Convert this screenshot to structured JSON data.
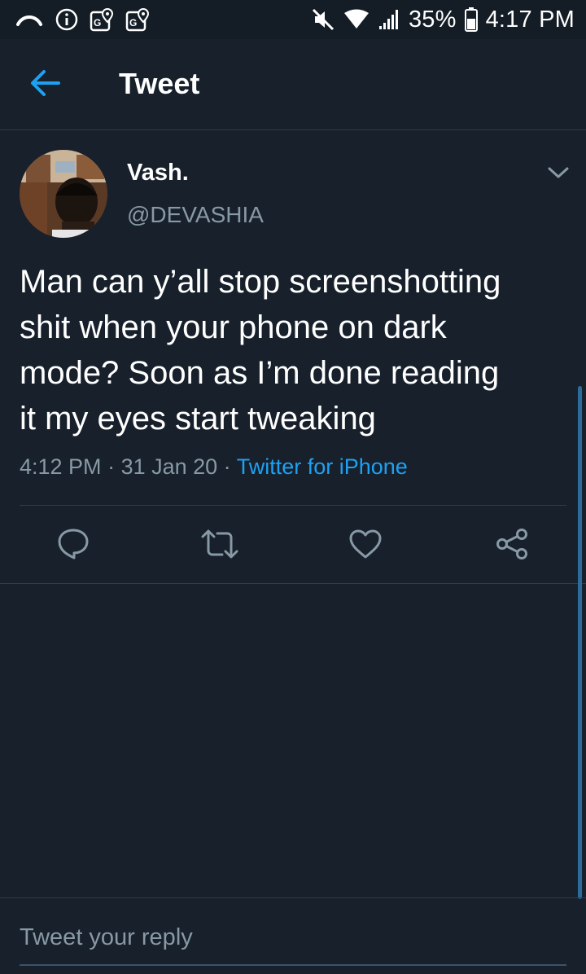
{
  "status_bar": {
    "battery": "35%",
    "time": "4:17 PM"
  },
  "app_bar": {
    "title": "Tweet"
  },
  "tweet": {
    "display_name": "Vash.",
    "handle": "@DEVASHIA",
    "lines": [
      "Man can y’all stop screenshotting",
      "shit when your phone on dark",
      "mode? Soon as I’m done reading",
      "it my eyes start tweaking"
    ],
    "time": "4:12 PM",
    "date": "31 Jan 20",
    "source": "Twitter for iPhone",
    "separator": " · "
  },
  "reply": {
    "placeholder": "Tweet your reply"
  },
  "colors": {
    "background": "#17202b",
    "accent": "#1da1f2",
    "secondary_text": "#8899a6"
  },
  "icons": {
    "back": "arrow-left-icon",
    "caret": "chevron-down-icon",
    "reply": "comment-icon",
    "retweet": "retweet-icon",
    "like": "heart-icon",
    "share": "share-icon"
  }
}
